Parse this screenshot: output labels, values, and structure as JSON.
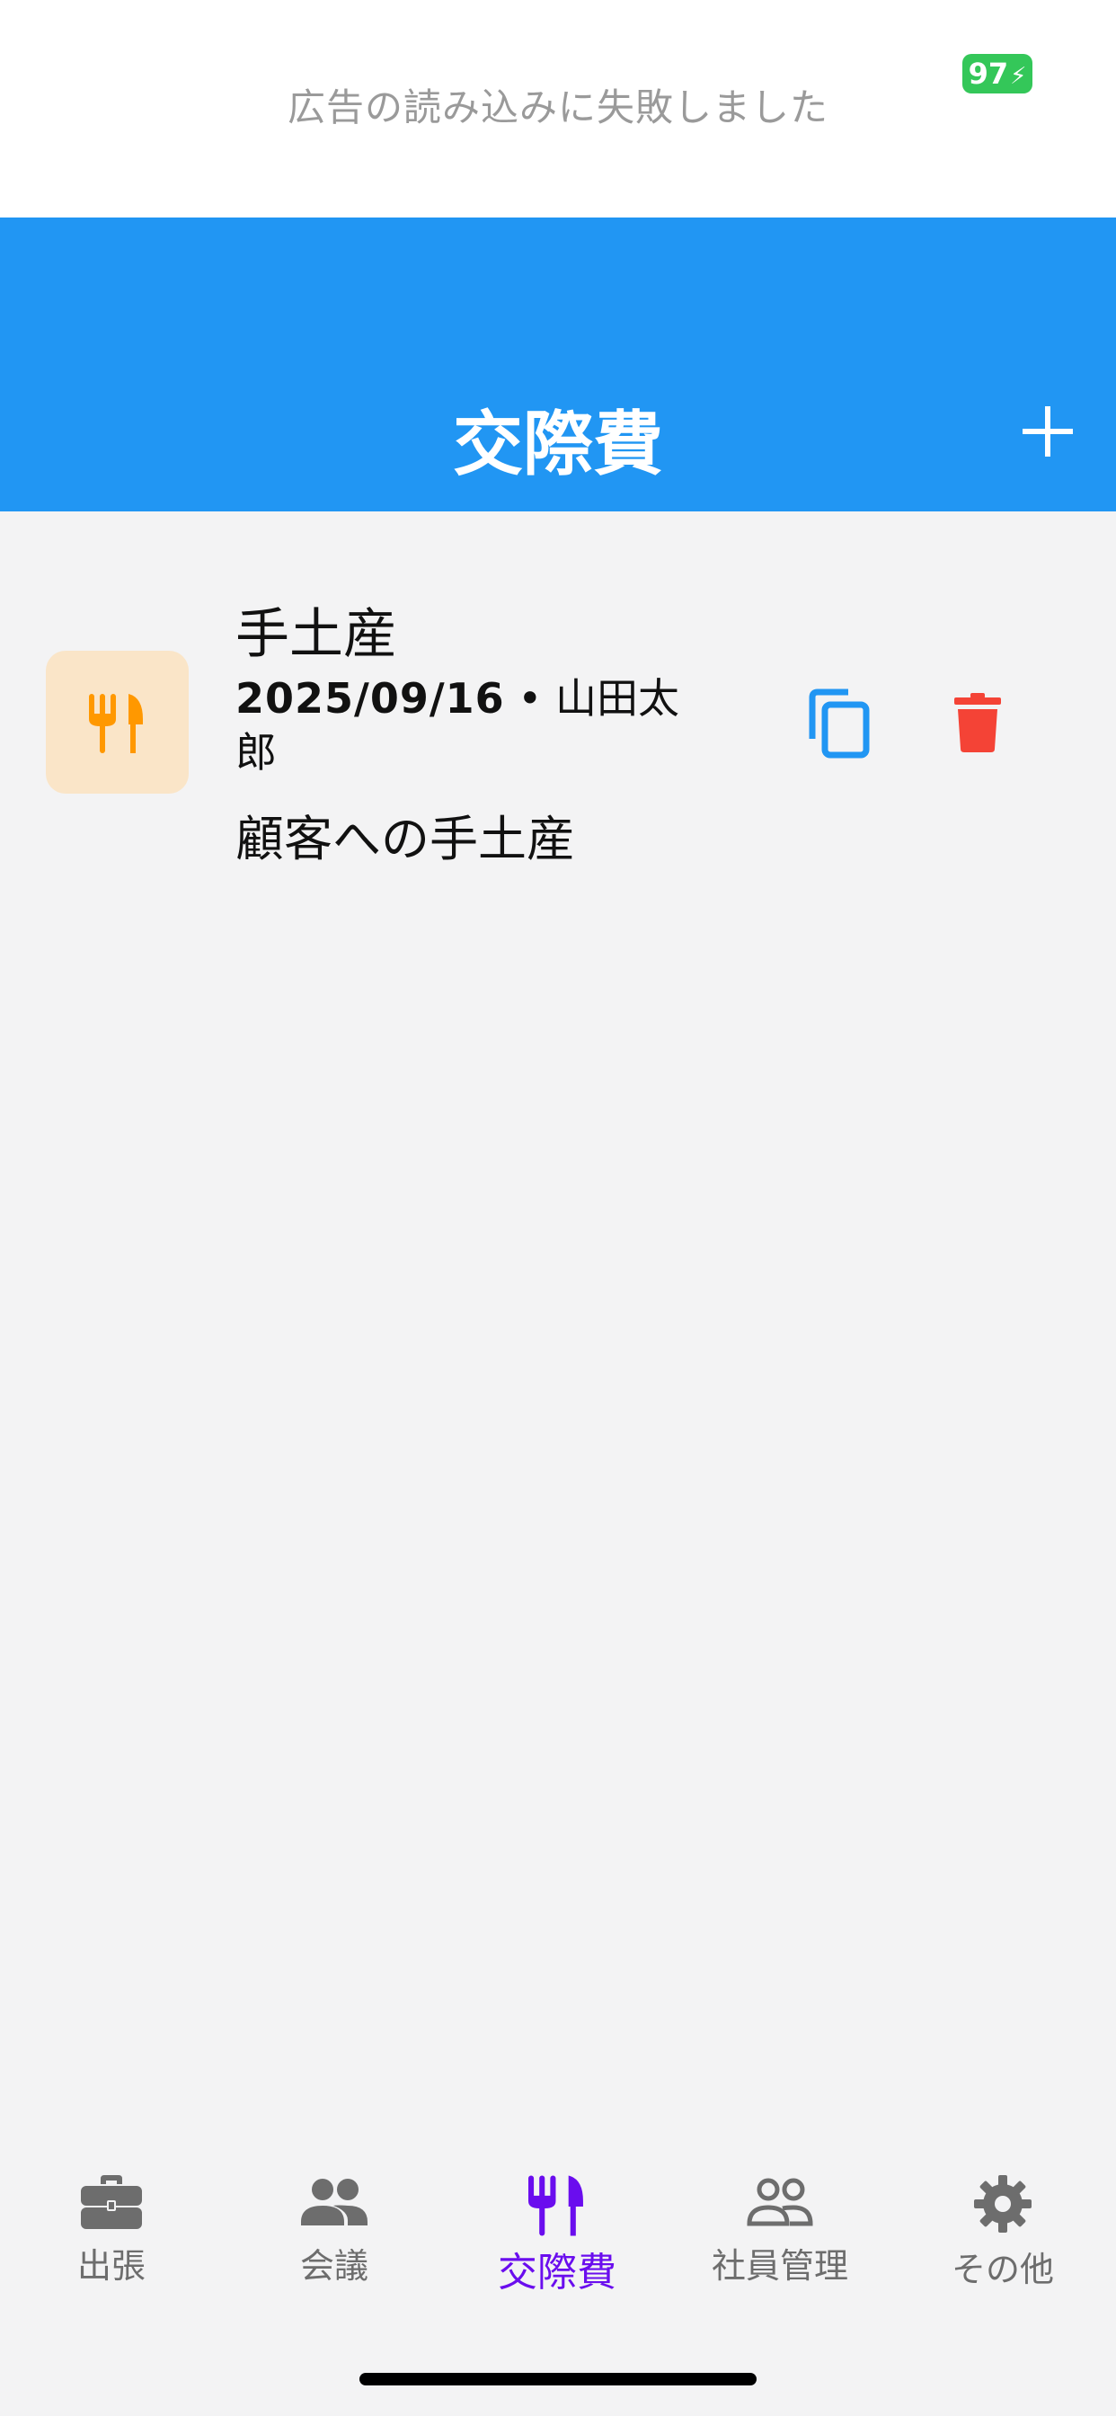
{
  "ad_banner": {
    "message": "広告の読み込みに失敗しました"
  },
  "status_bar": {
    "battery_level": "97"
  },
  "header": {
    "title": "交際費",
    "add_icon": "plus-icon"
  },
  "entries": [
    {
      "icon": "fork-knife-icon",
      "title": "手土産",
      "date": "2025/09/16",
      "separator": " • ",
      "person": "山田太郎",
      "description": "顧客への手土産",
      "copy_icon": "copy-icon",
      "delete_icon": "trash-icon"
    }
  ],
  "tabs": [
    {
      "label": "出張",
      "icon": "briefcase-icon",
      "active": false
    },
    {
      "label": "会議",
      "icon": "people-icon",
      "active": false
    },
    {
      "label": "交際費",
      "icon": "fork-knife-icon",
      "active": true
    },
    {
      "label": "社員管理",
      "icon": "people-outline-icon",
      "active": false
    },
    {
      "label": "その他",
      "icon": "gear-icon",
      "active": false
    }
  ],
  "colors": {
    "header": "#2196f3",
    "active_tab": "#6a0dee",
    "inactive_tab": "#6d6d6d",
    "copy": "#2196f3",
    "delete": "#f44336",
    "meal_icon": "#ff9800",
    "meal_icon_bg": "#fae5c8",
    "battery": "#34c759"
  }
}
